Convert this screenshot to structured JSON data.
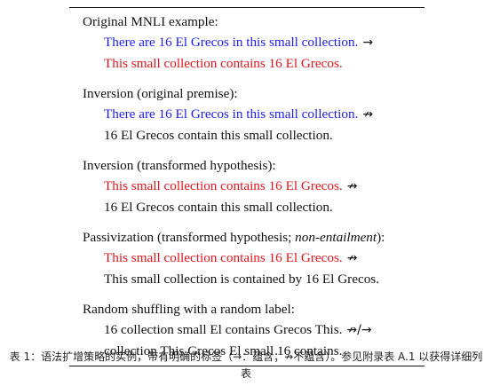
{
  "examples": [
    {
      "heading": "Original MNLI example:",
      "premise": "There are 16 El Grecos in this small collection.",
      "arrow": "→",
      "hypothesis": "This small collection contains 16 El Grecos."
    },
    {
      "heading": "Inversion (original premise):",
      "premise": "There are 16 El Grecos in this small collection.",
      "arrow": "↛",
      "hypothesis": "16 El Grecos contain this small collection."
    },
    {
      "heading": "Inversion (transformed hypothesis):",
      "premise": "This small collection contains 16 El Grecos.",
      "arrow": "↛",
      "hypothesis": "16 El Grecos contain this small collection."
    },
    {
      "heading_prefix": "Passivization (transformed hypothesis; ",
      "heading_italic": "non-entailment",
      "heading_suffix": "):",
      "premise": "This small collection contains 16 El Grecos.",
      "arrow": "↛",
      "hypothesis": "This small collection is contained by 16 El Grecos."
    },
    {
      "heading": "Random shuffling with a random label:",
      "premise": "16 collection small El contains Grecos This.",
      "arrow": "↛/→",
      "hypothesis": "collection This Grecos El small 16 contains."
    }
  ],
  "caption": "表 1：语法扩增策略的实例，带有明确的标签（→：蕴含；↛不蕴含）。参见附录表 A.1 以获得详细列表",
  "colors": {
    "original_sentence": "#1c1cf0",
    "transformed_sentence": "#e0141e",
    "text": "#111111"
  }
}
